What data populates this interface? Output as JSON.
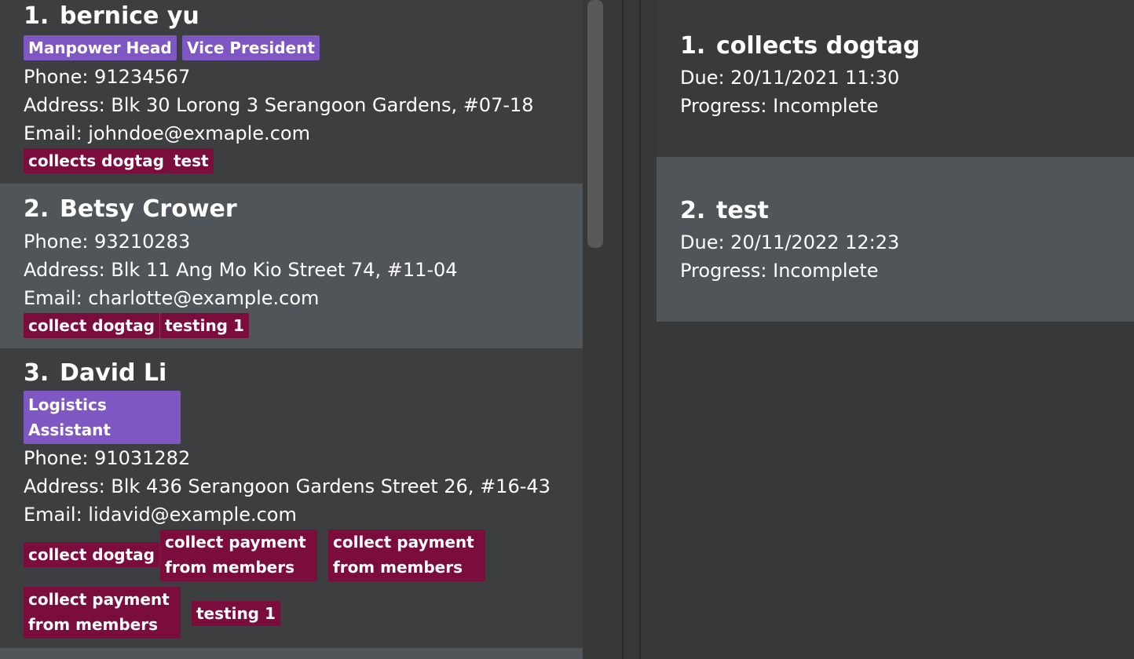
{
  "persons": [
    {
      "index": "1.",
      "name": "bernice yu",
      "roles": [
        "Manpower Head",
        "Vice President"
      ],
      "phone": "Phone: 91234567",
      "address": "Address: Blk 30 Lorong 3 Serangoon Gardens, #07-18",
      "email": "Email: johndoe@exmaple.com",
      "tasks": [
        "collects dogtag",
        "test"
      ]
    },
    {
      "index": "2.",
      "name": "Betsy Crower",
      "roles": [],
      "phone": "Phone: 93210283",
      "address": "Address: Blk 11 Ang Mo Kio Street 74, #11-04",
      "email": "Email: charlotte@example.com",
      "tasks": [
        "collect dogtag",
        "testing 1"
      ]
    },
    {
      "index": "3.",
      "name": "David Li",
      "roles": [
        "Logistics Assistant"
      ],
      "phone": "Phone: 91031282",
      "address": "Address: Blk 436 Serangoon Gardens Street 26, #16-43",
      "email": "Email: lidavid@example.com",
      "tasks": [
        "collect dogtag",
        "collect payment from members",
        "collect payment from members",
        "collect payment from members",
        "testing 1"
      ]
    }
  ],
  "task_list": [
    {
      "index": "1.",
      "title": "collects dogtag",
      "due": "Due: 20/11/2021 11:30",
      "progress": "Progress: Incomplete"
    },
    {
      "index": "2.",
      "title": "test",
      "due": "Due: 20/11/2022 12:23",
      "progress": "Progress: Incomplete"
    }
  ],
  "colors": {
    "role_tag": "#7e57c2",
    "task_tag": "#7a0d3c",
    "card_alt": "#4f5558",
    "background": "#383838"
  }
}
